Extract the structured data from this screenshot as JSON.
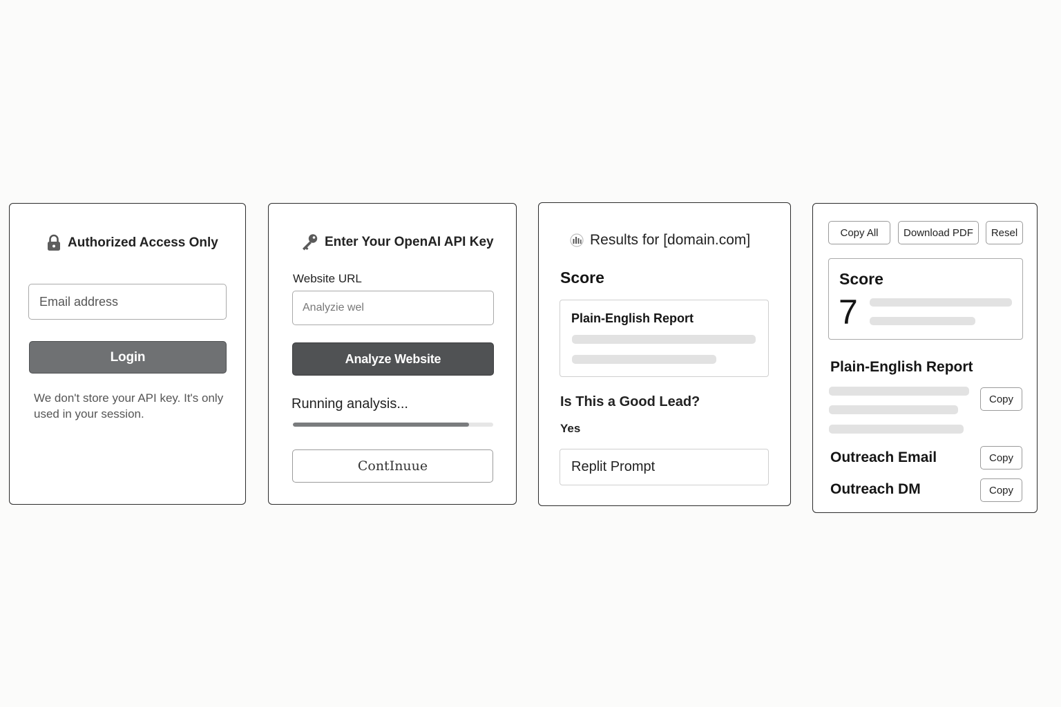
{
  "login_card": {
    "title": "Authorized Access Only",
    "title_icon": "lock-icon",
    "email_placeholder": "Email address",
    "login_label": "Login",
    "notice": "We don't store your API key. It's only used in your session."
  },
  "api_card": {
    "title": "Enter Your OpenAI API Key",
    "title_icon": "key-icon",
    "url_label": "Website URL",
    "url_placeholder": "Analyzie wel",
    "analyze_label": "Analyze Website",
    "status": "Running analysis...",
    "progress": 0.88,
    "continue_label": "ContInuue"
  },
  "results_card": {
    "title": "Results for [domain.com]",
    "title_icon": "bar-chart-icon",
    "score_heading": "Score",
    "report_heading": "Plain-English Report",
    "lead_heading": "Is This a Good Lead?",
    "lead_answer": "Yes",
    "prompt_label": "Replit Prompt"
  },
  "actions_card": {
    "copy_all_label": "Copy All",
    "download_label": "Download PDF",
    "reset_label": "Resel",
    "score_heading": "Score",
    "score_value": "7",
    "report_heading": "Plain-English Report",
    "report_copy_label": "Copy",
    "email_heading": "Outreach Email",
    "email_copy_label": "Copy",
    "dm_heading": "Outreach DM",
    "dm_copy_label": "Copy"
  },
  "colors": {
    "background": "#fbfbfa",
    "login_button": "#6f7173",
    "analyze_button": "#505254",
    "skeleton": "#e2e2e2",
    "progress_fill": "#7a7c7e"
  }
}
